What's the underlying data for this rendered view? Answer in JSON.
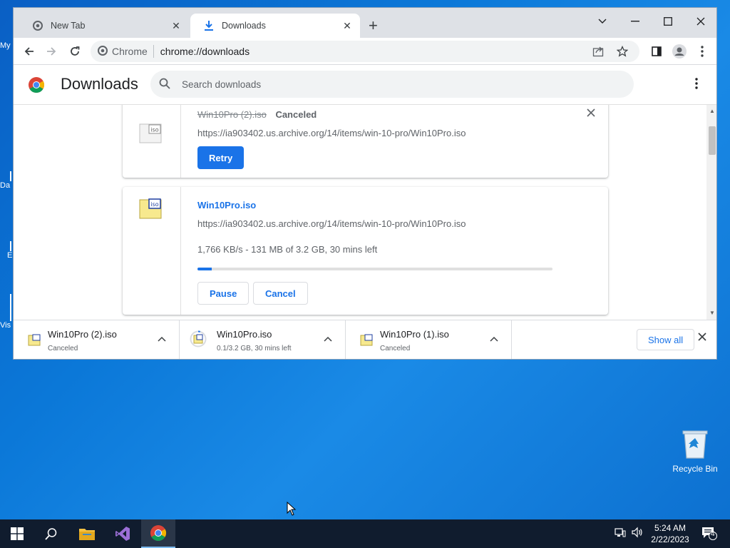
{
  "desktop": {
    "left_labels": [
      "My",
      "Da",
      "E",
      "Vis"
    ],
    "recycle_bin_label": "Recycle Bin"
  },
  "browser": {
    "tabs": [
      {
        "label": "New Tab",
        "icon": "chrome-icon"
      },
      {
        "label": "Downloads",
        "icon": "download-icon",
        "active": true
      }
    ],
    "omnibox": {
      "site_label": "Chrome",
      "url": "chrome://downloads"
    }
  },
  "downloads_page": {
    "title": "Downloads",
    "search_placeholder": "Search downloads",
    "items": [
      {
        "name": "Win10Pro (2).iso",
        "status": "Canceled",
        "url": "https://ia903402.us.archive.org/14/items/win-10-pro/Win10Pro.iso",
        "retry_label": "Retry"
      },
      {
        "name": "Win10Pro.iso",
        "url": "https://ia903402.us.archive.org/14/items/win-10-pro/Win10Pro.iso",
        "progress_text": "1,766 KB/s - 131 MB of 3.2 GB, 30 mins left",
        "progress_fraction": 0.04,
        "pause_label": "Pause",
        "cancel_label": "Cancel"
      }
    ]
  },
  "download_shelf": {
    "items": [
      {
        "name": "Win10Pro (2).iso",
        "status": "Canceled"
      },
      {
        "name": "Win10Pro.iso",
        "status": "0.1/3.2 GB, 30 mins left"
      },
      {
        "name": "Win10Pro (1).iso",
        "status": "Canceled"
      }
    ],
    "show_all_label": "Show all"
  },
  "taskbar": {
    "time": "5:24 AM",
    "date": "2/22/2023",
    "notification_count": "4"
  },
  "colors": {
    "accent": "#1a73e8",
    "taskbar": "#101c2e"
  }
}
